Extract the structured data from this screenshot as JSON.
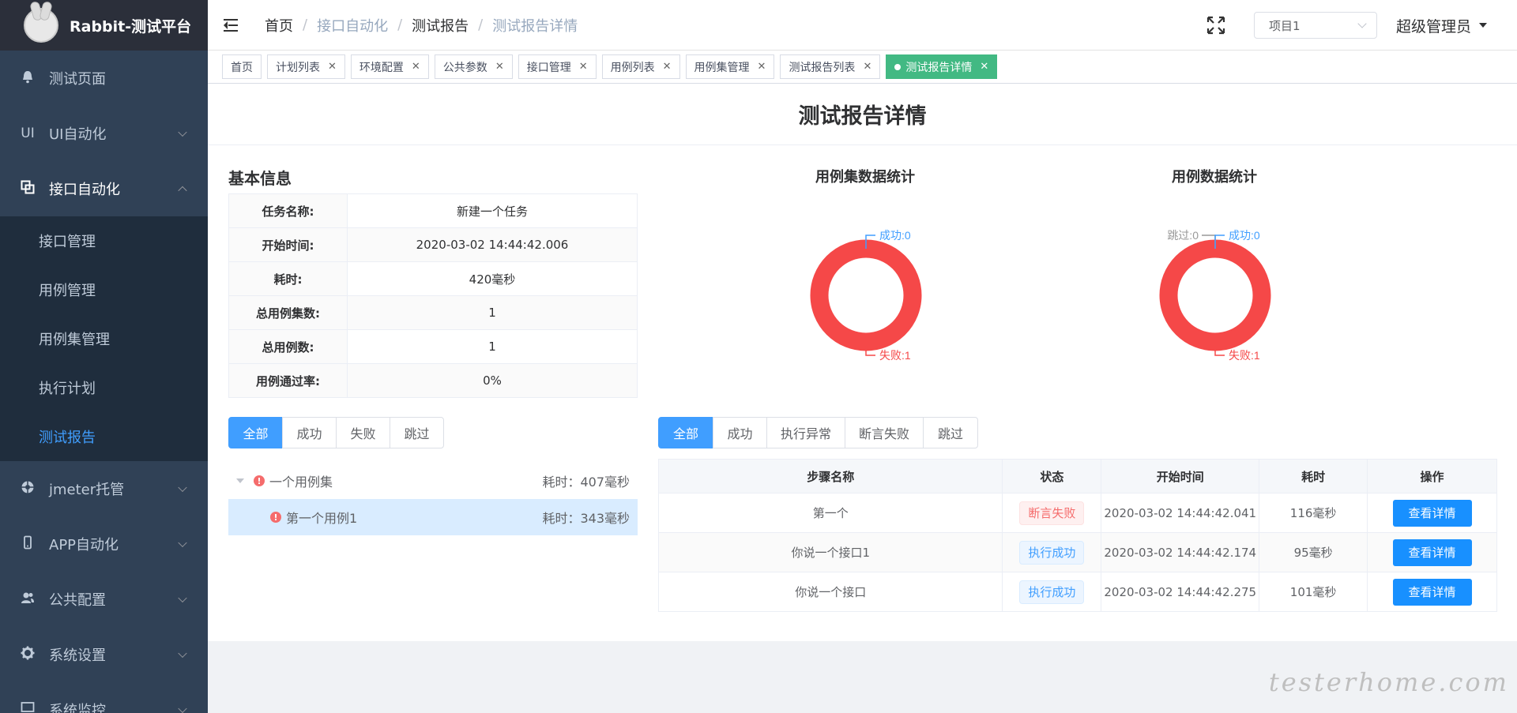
{
  "app": {
    "title": "Rabbit-测试平台"
  },
  "sidebar": {
    "items": [
      {
        "label": "测试页面",
        "icon": "bell-icon"
      },
      {
        "label": "UI自动化",
        "icon": "ui-text-icon",
        "icon_text": "UI"
      },
      {
        "label": "接口自动化",
        "icon": "copy-icon",
        "expanded": true,
        "children": [
          {
            "label": "接口管理"
          },
          {
            "label": "用例管理"
          },
          {
            "label": "用例集管理"
          },
          {
            "label": "执行计划"
          },
          {
            "label": "测试报告",
            "active": true
          }
        ]
      },
      {
        "label": "jmeter托管",
        "icon": "aperture-icon"
      },
      {
        "label": "APP自动化",
        "icon": "phone-icon"
      },
      {
        "label": "公共配置",
        "icon": "user-group-icon"
      },
      {
        "label": "系统设置",
        "icon": "gear-icon"
      },
      {
        "label": "系统监控",
        "icon": "monitor-icon"
      }
    ]
  },
  "navbar": {
    "breadcrumb": [
      "首页",
      "接口自动化",
      "测试报告",
      "测试报告详情"
    ],
    "project_select": "项目1",
    "user": "超级管理员"
  },
  "tags": [
    {
      "label": "首页",
      "closable": false
    },
    {
      "label": "计划列表",
      "closable": true
    },
    {
      "label": "环境配置",
      "closable": true
    },
    {
      "label": "公共参数",
      "closable": true
    },
    {
      "label": "接口管理",
      "closable": true
    },
    {
      "label": "用例列表",
      "closable": true
    },
    {
      "label": "用例集管理",
      "closable": true
    },
    {
      "label": "测试报告列表",
      "closable": true
    },
    {
      "label": "测试报告详情",
      "closable": true,
      "active": true
    }
  ],
  "page": {
    "title": "测试报告详情",
    "basic_info": {
      "title": "基本信息",
      "rows": [
        {
          "key": "任务名称:",
          "value": "新建一个任务"
        },
        {
          "key": "开始时间:",
          "value": "2020-03-02 14:44:42.006"
        },
        {
          "key": "耗时:",
          "value": "420毫秒"
        },
        {
          "key": "总用例集数:",
          "value": "1"
        },
        {
          "key": "总用例数:",
          "value": "1"
        },
        {
          "key": "用例通过率:",
          "value": "0%"
        }
      ]
    },
    "suite_chart": {
      "title": "用例集数据统计",
      "labels": {
        "success": "成功:0",
        "fail": "失败:1"
      }
    },
    "case_chart": {
      "title": "用例数据统计",
      "labels": {
        "skip": "跳过:0",
        "success": "成功:0",
        "fail": "失败:1"
      }
    },
    "left_filter": [
      "全部",
      "成功",
      "失败",
      "跳过"
    ],
    "right_filter": [
      "全部",
      "成功",
      "执行异常",
      "断言失败",
      "跳过"
    ],
    "tree": {
      "suite": {
        "label": "一个用例集",
        "time": "耗时：407毫秒"
      },
      "case": {
        "label": "第一个用例1",
        "time": "耗时：343毫秒"
      }
    },
    "steps": {
      "headers": [
        "步骤名称",
        "状态",
        "开始时间",
        "耗时",
        "操作"
      ],
      "rows": [
        {
          "name": "第一个",
          "status": "断言失败",
          "status_type": "fail",
          "start": "2020-03-02 14:44:42.041",
          "cost": "116毫秒",
          "action": "查看详情"
        },
        {
          "name": "你说一个接口1",
          "status": "执行成功",
          "status_type": "ok",
          "start": "2020-03-02 14:44:42.174",
          "cost": "95毫秒",
          "action": "查看详情"
        },
        {
          "name": "你说一个接口",
          "status": "执行成功",
          "status_type": "ok",
          "start": "2020-03-02 14:44:42.275",
          "cost": "101毫秒",
          "action": "查看详情"
        }
      ]
    }
  },
  "chart_data": [
    {
      "type": "pie",
      "title": "用例集数据统计",
      "categories": [
        "成功",
        "失败"
      ],
      "values": [
        0,
        1
      ],
      "colors": [
        "#409eff",
        "#f54848"
      ]
    },
    {
      "type": "pie",
      "title": "用例数据统计",
      "categories": [
        "跳过",
        "成功",
        "失败"
      ],
      "values": [
        0,
        0,
        1
      ],
      "colors": [
        "#999999",
        "#409eff",
        "#f54848"
      ]
    }
  ],
  "watermark": "testerhome.com",
  "colors": {
    "sidebar_bg": "#304156",
    "accent": "#409eff",
    "active_tag": "#42b983",
    "fail": "#f54848",
    "detail_button": "#1890ff"
  }
}
